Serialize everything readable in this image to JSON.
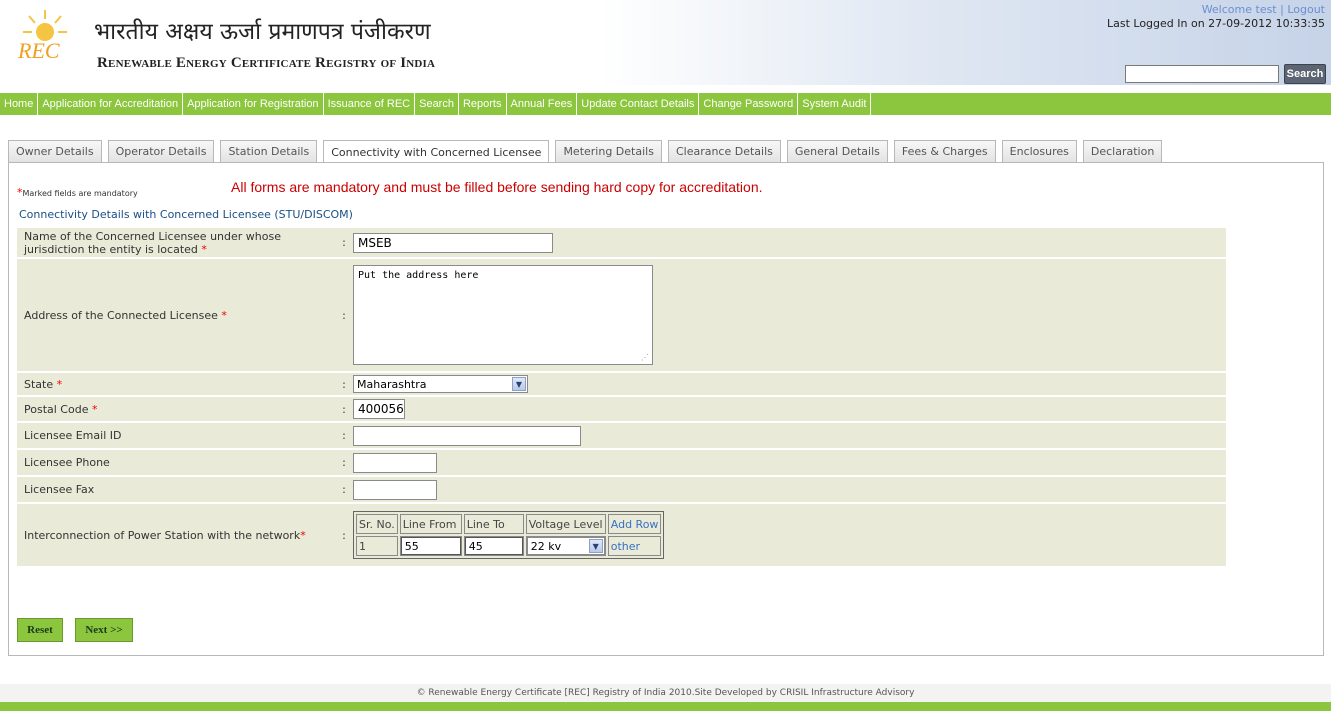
{
  "header": {
    "hindi_title": "भारतीय अक्षय ऊर्जा प्रमाणपत्र पंजीकरण",
    "english_title": "Renewable Energy Certificate Registry of India",
    "logo_text": "REC",
    "welcome": "Welcome test",
    "logout": "Logout",
    "last_login": "Last Logged In on 27-09-2012 10:33:35",
    "search_button": "Search",
    "search_value": ""
  },
  "nav": [
    "Home",
    "Application for Accreditation",
    "Application for Registration",
    "Issuance of REC",
    "Search",
    "Reports",
    "Annual Fees",
    "Update Contact Details",
    "Change Password",
    "System Audit"
  ],
  "tabs": [
    {
      "label": "Owner Details",
      "active": false
    },
    {
      "label": "Operator Details",
      "active": false
    },
    {
      "label": "Station Details",
      "active": false
    },
    {
      "label": "Connectivity with Concerned Licensee",
      "active": true
    },
    {
      "label": "Metering Details",
      "active": false
    },
    {
      "label": "Clearance Details",
      "active": false
    },
    {
      "label": "General Details",
      "active": false
    },
    {
      "label": "Fees & Charges",
      "active": false
    },
    {
      "label": "Enclosures",
      "active": false
    },
    {
      "label": "Declaration",
      "active": false
    }
  ],
  "notes": {
    "mandatory": "Marked fields are mandatory",
    "all_forms": "All forms are mandatory and must be filled before sending hard copy for accreditation."
  },
  "section_title": "Connectivity Details with Concerned Licensee (STU/DISCOM)",
  "form": {
    "licensee_name_label": "Name of the Concerned Licensee under whose jurisdiction the entity is located",
    "licensee_name_value": "MSEB",
    "address_label": "Address of the Connected Licensee",
    "address_value": "Put the address here",
    "state_label": "State",
    "state_value": "Maharashtra",
    "postal_label": "Postal Code",
    "postal_value": "400056",
    "email_label": "Licensee Email ID",
    "email_value": "",
    "phone_label": "Licensee Phone",
    "phone_value": "",
    "fax_label": "Licensee Fax",
    "fax_value": "",
    "interconnection_label": "Interconnection of Power Station with the network",
    "colon": ":"
  },
  "interconnection": {
    "headers": [
      "Sr. No.",
      "Line From",
      "Line To",
      "Voltage Level"
    ],
    "add_row": "Add Row",
    "row": {
      "sr": "1",
      "line_from": "55",
      "line_to": "45",
      "voltage": "22 kv",
      "other": "other"
    }
  },
  "buttons": {
    "reset": "Reset",
    "next": "Next >>"
  },
  "footer": "© Renewable Energy Certificate [REC] Registry of India 2010.Site Developed by CRISIL Infrastructure Advisory",
  "colors": {
    "nav_green": "#8cc63f",
    "mandatory_red": "#cc0000",
    "link_blue": "#3a6fc4"
  }
}
